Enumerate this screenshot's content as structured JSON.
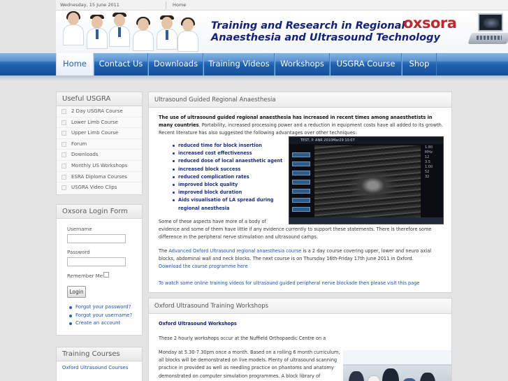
{
  "topbar": {
    "date": "Wednesday, 15 June 2011",
    "home_link": "Home"
  },
  "banner": {
    "title_line1": "Training and Research in Regional",
    "title_line2": "Anaesthesia and Ultrasound Technology",
    "brand": "oxsora",
    "brand_color": "#c1282e",
    "title_color": "#13217a"
  },
  "nav": {
    "items": [
      "Home",
      "Contact Us",
      "Downloads",
      "Training Videos",
      "Workshops",
      "USGRA Course",
      "Shop"
    ],
    "active": "Home",
    "color": "#1e5fae"
  },
  "sidebar": {
    "useful_title": "Useful USGRA",
    "useful_items": [
      "2 Day USGRA Course",
      "Lower Limb Course",
      "Upper Limb Course",
      "Forum",
      "Downloads",
      "Monthly US Workshops",
      "ESRA Diploma Courses",
      "USGRA Video Clips"
    ],
    "login": {
      "title": "Oxsora Login Form",
      "username_label": "Username",
      "password_label": "Password",
      "remember_label": "Remember Me",
      "button": "Login",
      "links": [
        "Forgot your password?",
        "Forgot your username?",
        "Create an account"
      ]
    },
    "courses_title": "Training Courses",
    "courses_link": "Oxford Ultrasound Courses"
  },
  "main": {
    "article1": {
      "title": "Ultrasound Guided Regional Anaesthesia",
      "intro_bold": "The use of ultrasound guided regional anaesthesia has increased in recent times among anaesthetists in many countries",
      "intro_rest": ". Portability, increased processing power and a reduction in equipment costs have all added to its growth. Recent literature has also suggested the following advantages over other techniques:",
      "benefits": [
        "reduced time for block insertion",
        "increased cost effectiveness",
        "reduced dose of local anaesthetic agent",
        "increased block success",
        "reduced complication rates",
        "improved block quality",
        "improved block duration",
        "Aids visualisatio of LA spread during regional anesthesia"
      ],
      "para2_a": "Some of these aspects have more of a body of",
      "para2_b": "evidence and some of them have little if any evidence currently to support these statements. There is therefore some difference in the peripheral nerve stimulation and ultrasound camps.",
      "para3_pre": "The ",
      "para3_link": "Advanced Oxford Ultrasound regional anaesthesia course",
      "para3_post": " is a 2 day course covering upper, lower and neuro axial blocks, abdominal wall and neck blocks. The next course is on Thursday 16th-Friday 17th June 2011 in Oxford.",
      "download_link": "Download the course programme here",
      "videos_link": "To watch some online training videos for ultrasound guided peripheral nerve blockade then please visit this page"
    },
    "ultrasound_screen": {
      "header": "TEST, P.          ANR 2010Mar29 10:07",
      "readouts": [
        "1.80",
        "MHz",
        "12",
        "3.5",
        "1.00",
        "52",
        "32"
      ]
    },
    "article2": {
      "title": "Oxford Ultrasound Training Workshops",
      "link": "Oxford Ultrasound Workshops",
      "para1": "These 2 hourly workshops occur at the Nuffield Orthopaedic Centre on a",
      "para2": "Monday at 5.30-7.30pm once a month. Based on a rolling 6 month curriculum, all blocks will be demonstrated on live models. Plenty of ultrasound scanning practice in provided as well as needling practice on phantoms and anatomy demonstrated on computer simulation programmes. A block library of"
    }
  }
}
